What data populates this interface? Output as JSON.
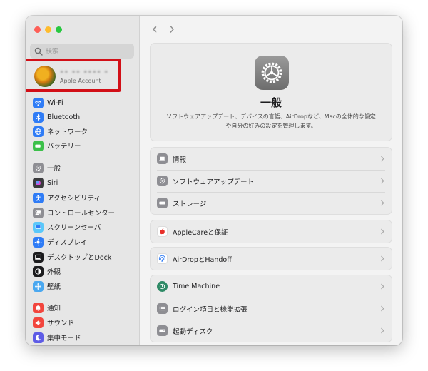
{
  "search": {
    "placeholder": "検索"
  },
  "account": {
    "name": "•• •• •••• •",
    "subtitle": "Apple Account"
  },
  "sidebar": {
    "items": [
      {
        "label": "Wi-Fi",
        "icon": "wifi-icon",
        "color": "#2f7cf6"
      },
      {
        "label": "Bluetooth",
        "icon": "bluetooth-icon",
        "color": "#2f7cf6"
      },
      {
        "label": "ネットワーク",
        "icon": "globe-icon",
        "color": "#2f7cf6"
      },
      {
        "label": "バッテリー",
        "icon": "battery-icon",
        "color": "#3cc04a"
      },
      {
        "label": "一般",
        "icon": "gear-icon",
        "color": "#8e8e93"
      },
      {
        "label": "Siri",
        "icon": "siri-icon",
        "color": "#3a3a3c"
      },
      {
        "label": "アクセシビリティ",
        "icon": "accessibility-icon",
        "color": "#2f7cf6"
      },
      {
        "label": "コントロールセンター",
        "icon": "control-center-icon",
        "color": "#8e8e93"
      },
      {
        "label": "スクリーンセーバ",
        "icon": "screensaver-icon",
        "color": "#5ac8fa"
      },
      {
        "label": "ディスプレイ",
        "icon": "display-icon",
        "color": "#2f7cf6"
      },
      {
        "label": "デスクトップとDock",
        "icon": "dock-icon",
        "color": "#1c1c1e"
      },
      {
        "label": "外観",
        "icon": "appearance-icon",
        "color": "#1c1c1e"
      },
      {
        "label": "壁紙",
        "icon": "wallpaper-icon",
        "color": "#4aa8f0"
      },
      {
        "label": "通知",
        "icon": "notification-icon",
        "color": "#f2453d"
      },
      {
        "label": "サウンド",
        "icon": "sound-icon",
        "color": "#f2453d"
      },
      {
        "label": "集中モード",
        "icon": "focus-icon",
        "color": "#5e5ce6"
      }
    ]
  },
  "hero": {
    "title": "一般",
    "description": "ソフトウェアアップデート、デバイスの言語、AirDropなど、Macの全体的な設定や自分の好みの設定を管理します。"
  },
  "groups": [
    {
      "rows": [
        {
          "label": "情報",
          "icon": "laptop-icon",
          "color": "#8e8e93"
        },
        {
          "label": "ソフトウェアアップデート",
          "icon": "update-gear-icon",
          "color": "#8e8e93"
        },
        {
          "label": "ストレージ",
          "icon": "storage-icon",
          "color": "#8e8e93"
        }
      ]
    },
    {
      "rows": [
        {
          "label": "AppleCareと保証",
          "icon": "apple-icon",
          "color": "#ffffff"
        }
      ]
    },
    {
      "rows": [
        {
          "label": "AirDropとHandoff",
          "icon": "airdrop-icon",
          "color": "#ffffff"
        }
      ]
    },
    {
      "rows": [
        {
          "label": "Time Machine",
          "icon": "time-machine-icon",
          "color": "#2e8a66"
        },
        {
          "label": "ログイン項目と機能拡張",
          "icon": "list-icon",
          "color": "#8e8e93"
        },
        {
          "label": "起動ディスク",
          "icon": "disk-icon",
          "color": "#8e8e93"
        }
      ]
    }
  ]
}
